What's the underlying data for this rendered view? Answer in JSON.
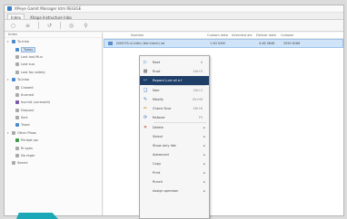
{
  "window": {
    "title": "XPeye Gamit Manager ktm REGIGE"
  },
  "menu": {
    "tabs": [
      "Index",
      "Xhapa Instructure Inbo"
    ]
  },
  "sidebar": {
    "header": "Index",
    "items": [
      {
        "label": "To-Inbo",
        "icon": "folder-icon"
      },
      {
        "label": "Todos",
        "icon": "inbox-icon"
      },
      {
        "label": "Last last Mun",
        "icon": "folder-icon"
      },
      {
        "label": "Last suo",
        "icon": "folder-icon"
      },
      {
        "label": "Last fou satety",
        "icon": "folder-icon"
      },
      {
        "label": "To-Inbo",
        "icon": "folder-icon"
      },
      {
        "label": "Crowed",
        "icon": "folder-icon"
      },
      {
        "label": "Iturmed",
        "icon": "folder-icon"
      },
      {
        "label": "Isurnid (unresorti)",
        "icon": "folder-icon"
      },
      {
        "label": "Dropost",
        "icon": "folder-icon"
      },
      {
        "label": "Sert",
        "icon": "send-icon"
      },
      {
        "label": "Trsed",
        "icon": "trash-icon"
      },
      {
        "label": "Other Plaos",
        "icon": "folder-icon"
      },
      {
        "label": "Pimbat ow",
        "icon": "flag-icon"
      },
      {
        "label": "Ri spes",
        "icon": "folder-icon"
      },
      {
        "label": "No reger",
        "icon": "folder-icon"
      },
      {
        "label": "Searct",
        "icon": "search-icon"
      }
    ]
  },
  "table": {
    "columns": [
      "Number",
      "Custom data",
      "Intended ale",
      "Deliver date",
      "Colower"
    ],
    "row": {
      "subject": "DOM R5-4-Ltttle (Itot Intent) ad",
      "custom": "1 AO KAM",
      "intended": "",
      "delivery": "4.46 4646",
      "other": "2090 6186"
    }
  },
  "context_menu": {
    "items": [
      {
        "label": "Reet",
        "shortcut": "X",
        "icon": "open-icon"
      },
      {
        "label": "Rnot",
        "shortcut": "Ctrl+S",
        "icon": "print-icon"
      },
      {
        "label": "Rapard (unt ail e.f",
        "shortcut": "",
        "icon": "reply-icon"
      },
      {
        "label": "Nerr",
        "shortcut": "Ctrl+2",
        "icon": "new-icon"
      },
      {
        "label": "Mealfy",
        "shortcut": "Ctrl+M",
        "icon": "edit-icon"
      },
      {
        "label": "Chece Dcor",
        "shortcut": "Ctrl+K",
        "icon": "brush-icon"
      },
      {
        "label": "Rafover",
        "shortcut": "F5",
        "icon": "refresh-icon"
      },
      {
        "label": "Delete",
        "shortcut": "",
        "icon": "delete-icon"
      },
      {
        "label": "Select",
        "shortcut": "",
        "icon": ""
      },
      {
        "label": "Show only like",
        "shortcut": "",
        "icon": ""
      },
      {
        "label": "Advanced",
        "shortcut": "",
        "icon": ""
      },
      {
        "label": "Copy",
        "shortcut": "",
        "icon": ""
      },
      {
        "label": "Print",
        "shortcut": "",
        "icon": ""
      },
      {
        "label": "Runch",
        "shortcut": "",
        "icon": ""
      },
      {
        "label": "Assign opersion",
        "shortcut": "",
        "icon": ""
      }
    ]
  },
  "colors": {
    "accent": "#1f3f68",
    "selection": "#cfe4f8",
    "teal": "#1aa8b8"
  }
}
